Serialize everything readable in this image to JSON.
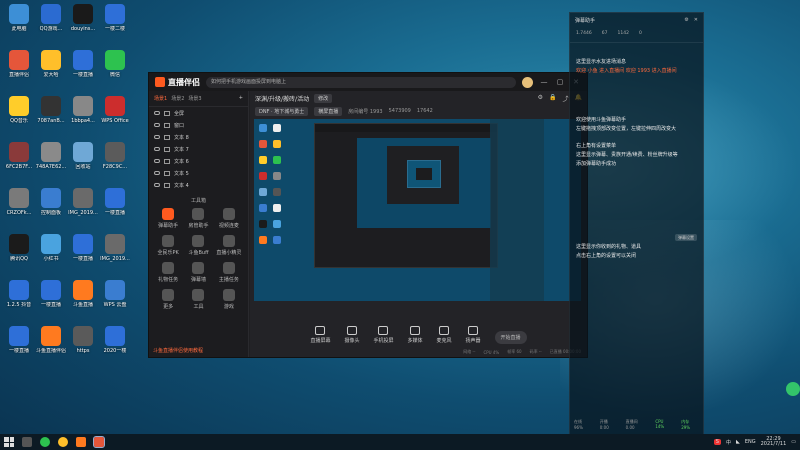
{
  "desktop": {
    "icons": [
      {
        "label": "此电脑",
        "color": "#3d8fd6"
      },
      {
        "label": "QQ游戏...",
        "color": "#2b6bd1"
      },
      {
        "label": "douyins...",
        "color": "#1a1a1a"
      },
      {
        "label": "一楼二楼",
        "color": "#2e6fd8"
      },
      {
        "label": "直播伴侣",
        "color": "#e5563a"
      },
      {
        "label": "爱大哈",
        "color": "#ffbf2a"
      },
      {
        "label": "一楼直播",
        "color": "#2e6fd8"
      },
      {
        "label": "微信",
        "color": "#2dc24f"
      },
      {
        "label": "QQ音乐",
        "color": "#ffcd2a"
      },
      {
        "label": "7087anB...",
        "color": "#333"
      },
      {
        "label": "1bbpa4...",
        "color": "#888"
      },
      {
        "label": "WPS Office",
        "color": "#cc2d2d"
      },
      {
        "label": "6FC2B7F...",
        "color": "#8a3a3a"
      },
      {
        "label": "748A7E62...",
        "color": "#8a8a8a"
      },
      {
        "label": "回收站",
        "color": "#6fa8d6"
      },
      {
        "label": "F28C9C...",
        "color": "#5b5b5b"
      },
      {
        "label": "CRZOFk...",
        "color": "#7a7a7a"
      },
      {
        "label": "控制面板",
        "color": "#3a7dd0"
      },
      {
        "label": "IMG_2019...",
        "color": "#6a6a6a"
      },
      {
        "label": "一楼直播",
        "color": "#2e6fd8"
      },
      {
        "label": "腾讯QQ",
        "color": "#1b1b1b"
      },
      {
        "label": "小红书",
        "color": "#4aa3df"
      },
      {
        "label": "一楼直播",
        "color": "#2e6fd8"
      },
      {
        "label": "IMG_2019...",
        "color": "#6a6a6a"
      },
      {
        "label": "1.2.5 抖音",
        "color": "#2e6fd8"
      },
      {
        "label": "一楼直播",
        "color": "#2e6fd8"
      },
      {
        "label": "斗鱼直播",
        "color": "#ff7a1f"
      },
      {
        "label": "WPS 云盘",
        "color": "#3a7dd0"
      },
      {
        "label": "一楼直播",
        "color": "#2e6fd8"
      },
      {
        "label": "斗鱼直播伴侣",
        "color": "#ff7a1f"
      },
      {
        "label": "https",
        "color": "#5a5a5a"
      },
      {
        "label": "2020一楼",
        "color": "#2e6fd8"
      }
    ]
  },
  "app": {
    "logo": "直播伴侣",
    "notice": "如何把手机游戏画面投屏到电脑上",
    "window_controls": [
      "—",
      "▢",
      "✕"
    ],
    "scene_tabs": [
      "场景1",
      "场景2",
      "场景3"
    ],
    "active_scene": "场景1",
    "add_scene": "+",
    "sources": [
      "全屏",
      "窗口",
      "文本 8",
      "文本 7",
      "文本 6",
      "文本 5",
      "文本 4"
    ],
    "toolbox_title": "工具箱",
    "tools": [
      {
        "label": "弹幕助手",
        "color": "#ff5a1f"
      },
      {
        "label": "房管助手",
        "color": "#555"
      },
      {
        "label": "视频连麦",
        "color": "#555"
      },
      {
        "label": "全民乐PK",
        "color": "#555"
      },
      {
        "label": "斗鱼Buff",
        "color": "#555"
      },
      {
        "label": "直播小精灵",
        "color": "#555"
      },
      {
        "label": "礼物任务",
        "color": "#555"
      },
      {
        "label": "弹幕墙",
        "color": "#555"
      },
      {
        "label": "主播任务",
        "color": "#555"
      },
      {
        "label": "更多",
        "color": "#555"
      },
      {
        "label": "工具",
        "color": "#555"
      },
      {
        "label": "游戏",
        "color": "#555"
      }
    ],
    "warn": "斗鱼直播伴侣使用教程",
    "header": {
      "room_title": "深渊/升级/搬砖/活动",
      "edit": "修改",
      "category": "DNF · 地下城与勇士",
      "layout_btn": "横屏直播",
      "room_id": "房间编号 1993",
      "fans": "5473909",
      "hot": "17642"
    },
    "bottom_buttons": [
      "直播屏幕",
      "摄像头",
      "手机投屏",
      "多媒体",
      "麦克风",
      "扬声器"
    ],
    "live_button": "开始直播",
    "status": [
      "网络 --",
      "CPU 4%",
      "帧率 60",
      "码率 --",
      "已直播 00:00:00"
    ]
  },
  "chat": {
    "title": "弹幕助手",
    "stats": [
      "1.7446",
      "67",
      "1142",
      "0"
    ],
    "messages": [
      {
        "text": "这里显示水友进场消息",
        "highlight": false
      },
      {
        "text": "欢迎 小鱼 进入直播间 欢迎 1993 进入直播间",
        "highlight": true
      },
      {
        "text": "欢迎使用斗鱼弹幕助手",
        "highlight": false
      },
      {
        "text": "左键拖拽顶部改变位置，左键拉伸四周改变大",
        "highlight": false
      },
      {
        "text": "右上角有设置菜单",
        "highlight": false
      },
      {
        "text": "这里显示弹幕、贵族开通/续费、粉丝牌升级等",
        "highlight": false
      },
      {
        "text": "添加弹幕助手成功",
        "highlight": false
      },
      {
        "text": "这里显示你收到的礼物、道具",
        "highlight": false
      },
      {
        "text": "点击右上角的设置可以关闭",
        "highlight": false
      }
    ],
    "badge": "弹幕设置",
    "footer": [
      "在线 96%",
      "开播 0:00",
      "直播间 0.00",
      "CPU 14%",
      "内存 29%"
    ]
  },
  "taskbar": {
    "time": "22:29",
    "date": "2021/7/11",
    "tray": [
      "S",
      "中",
      "◣",
      "ENG"
    ]
  }
}
